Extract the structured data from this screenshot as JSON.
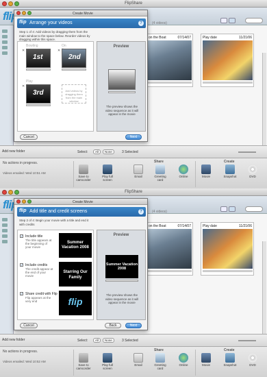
{
  "app": {
    "title": "FlipShare",
    "logo": "flip",
    "video_count": "(4 videos)"
  },
  "clips": [
    {
      "title": "Boy on the Boat",
      "date": "07/14/07"
    },
    {
      "title": "Play date",
      "date": "11/21/06"
    }
  ],
  "selectbar": {
    "add_folder": "Add new folder",
    "select_label": "Select:",
    "all_label": "All",
    "none_label": "None",
    "selected": "3 Selected"
  },
  "status": {
    "progress": "No actions in progress.",
    "row1": "Videos emailed: Wed 10:51 AM",
    "row2": "Videos emailed: Wed 10:52 AM"
  },
  "share": {
    "share_label": "Share",
    "create_label": "Create",
    "actions": [
      {
        "label": "Save to camcorder",
        "icon": "camcorder-icon"
      },
      {
        "label": "Play full screen",
        "icon": "fullscreen-icon"
      },
      {
        "label": "Email",
        "icon": "email-icon"
      },
      {
        "label": "Greeting card",
        "icon": "greeting-card-icon"
      },
      {
        "label": "Online",
        "icon": "globe-icon"
      },
      {
        "label": "Movie",
        "icon": "movie-icon"
      },
      {
        "label": "Snapshot",
        "icon": "snapshot-icon"
      },
      {
        "label": "DVD",
        "icon": "dvd-icon"
      }
    ]
  },
  "dialog1": {
    "window_title": "Create Movie",
    "heading": "Arrange your videos",
    "step": "Step 1 of 4: Add videos by dragging them from the main window to the space below. Reorder videos by dragging within this space.",
    "clips": [
      {
        "label": "Bowling",
        "tag": "1st"
      },
      {
        "label": "On the Boat",
        "tag": "2nd"
      },
      {
        "label": "Play date",
        "tag": "3rd"
      }
    ],
    "empty_slot": "Add videos by dragging them from the main window",
    "preview_title": "Preview",
    "preview_desc": "The preview shows the video sequence as it will appear in the movie",
    "cancel": "Cancel",
    "next": "Next"
  },
  "dialog2": {
    "window_title": "Create Movie",
    "heading": "Add title and credit screens",
    "step": "Step 2 of 4: Begin your movie with a title and end it with credits",
    "rows": [
      {
        "check": "✓",
        "title": "Include title",
        "desc": "The title appears at the beginning of your movie",
        "card": "Summer Vacation 2008"
      },
      {
        "check": "✓",
        "title": "Include credits",
        "desc": "The credit appear at the end of your movie",
        "card": "Starring Our Family"
      },
      {
        "check": "✓",
        "title": "Share credit with Flip",
        "desc": "Flip appears at the very end",
        "card": "flip"
      }
    ],
    "preview_title": "Preview",
    "preview_card": "Summer Vacation 2008",
    "preview_desc": "The preview shows the video sequence as it will appear in the movie",
    "cancel": "Cancel",
    "back": "Back",
    "next": "Next"
  },
  "colors": {
    "accent": "#3d86d3",
    "header": "#2a6aab"
  }
}
